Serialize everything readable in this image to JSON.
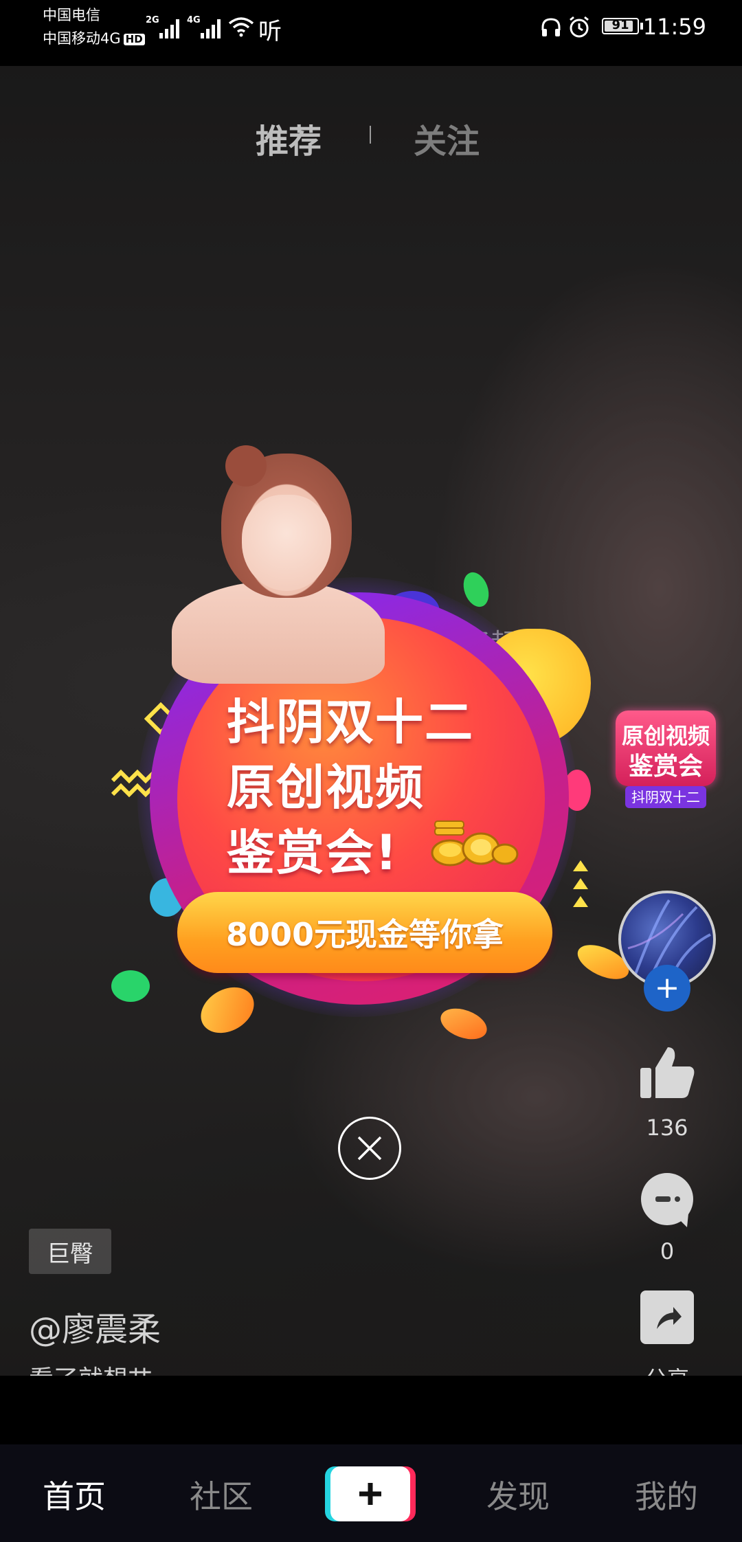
{
  "status_bar": {
    "carrier_1": "中国电信",
    "carrier_2": "中国移动4G",
    "hd": "HD",
    "net_1": "2G",
    "net_2": "4G",
    "listen_glyph": "听",
    "battery": "91",
    "time": "11:59",
    "icons": [
      "headphones-icon",
      "alarm-icon",
      "wifi-icon",
      "signal-icon"
    ]
  },
  "top_tabs": [
    {
      "label": "推荐",
      "active": true
    },
    {
      "label": "关注",
      "active": false
    }
  ],
  "popup": {
    "line_1": "抖阴双十二",
    "line_2": "原创视频",
    "line_3": "鉴赏会!",
    "cta": "8000元现金等你拿"
  },
  "background_fragment": "了赶快",
  "sidebar": {
    "badge_line_1": "原创视频",
    "badge_line_2": "鉴赏会",
    "badge_ribbon": "抖阴双十二",
    "likes": "136",
    "comments": "0",
    "share_label": "分享"
  },
  "video_info": {
    "tag": "巨臀",
    "author": "@廖震柔",
    "caption": "看了就想艹"
  },
  "bottom_nav": [
    {
      "label": "首页",
      "active": true
    },
    {
      "label": "社区",
      "active": false
    },
    {
      "label": "发现",
      "active": false
    },
    {
      "label": "我的",
      "active": false
    }
  ],
  "colors": {
    "accent_blue": "#1e64c8",
    "popup_red": "#ff4a45",
    "popup_purple": "#7a2cff",
    "pill_orange": "#ffa020"
  }
}
